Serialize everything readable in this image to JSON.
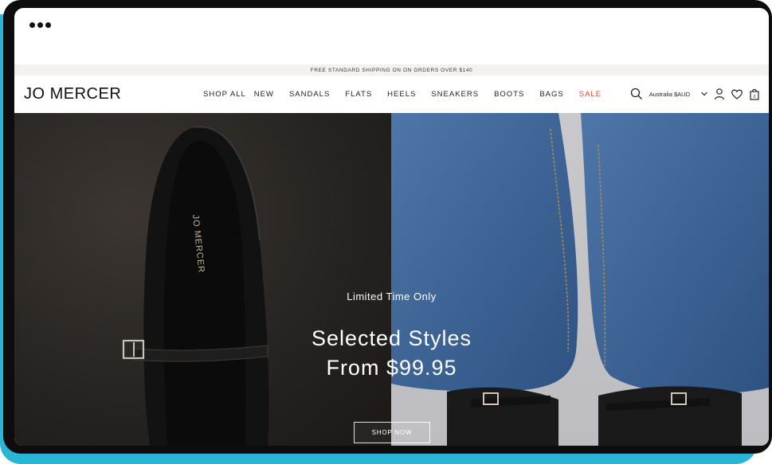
{
  "browser": {
    "menu_icon": "three-dots-icon"
  },
  "promo_bar": {
    "text": "FREE STANDARD SHIPPING ON ON ORDERS OVER $140"
  },
  "header": {
    "logo": "JO MERCER",
    "menu": [
      "SHOP ALL",
      "NEW",
      "SANDALS",
      "FLATS",
      "HEELS",
      "SNEAKERS",
      "BOOTS",
      "BAGS",
      "SALE"
    ],
    "currency": "Australia $AUD",
    "icons": [
      "search-icon",
      "chevron-down-icon",
      "account-icon",
      "wishlist-heart-icon",
      "bag-icon"
    ],
    "sale_color": "#e0453c"
  },
  "hero": {
    "kicker": "Limited Time Only",
    "headline_line1": "Selected Styles",
    "headline_line2": "From $99.95",
    "cta": "SHOP NOW",
    "insole_brand": "JO MERCER"
  },
  "colors": {
    "frame_accent": "#29b6d6",
    "device": "#0d0d0d"
  }
}
